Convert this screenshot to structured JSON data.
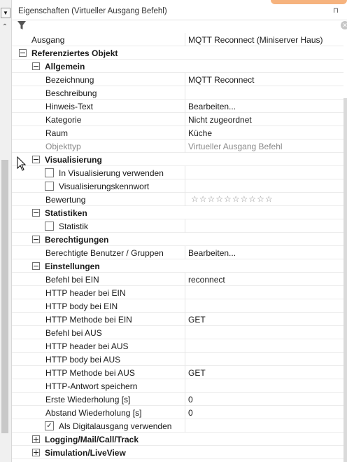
{
  "window": {
    "title": "Eigenschaften (Virtueller Ausgang Befehl)",
    "pin_glyph": "⊓",
    "clear_glyph": "✕"
  },
  "colors": {
    "accent": "#f6b37e",
    "disabled": "#8a8a8a"
  },
  "rows": {
    "ausgang": {
      "label": "Ausgang",
      "value": "MQTT Reconnect (Miniserver Haus)"
    },
    "ref_objekt": {
      "label": "Referenziertes Objekt"
    },
    "allgemein": {
      "label": "Allgemein"
    },
    "bezeichnung": {
      "label": "Bezeichnung",
      "value": "MQTT Reconnect"
    },
    "beschreibung": {
      "label": "Beschreibung",
      "value": ""
    },
    "hinweis": {
      "label": "Hinweis-Text",
      "value": "Bearbeiten..."
    },
    "kategorie": {
      "label": "Kategorie",
      "value": "Nicht zugeordnet"
    },
    "raum": {
      "label": "Raum",
      "value": "Küche"
    },
    "objekttyp": {
      "label": "Objekttyp",
      "value": "Virtueller Ausgang Befehl"
    },
    "visualisierung": {
      "label": "Visualisierung"
    },
    "in_visu": {
      "label": "In Visualisierung verwenden",
      "checked": false
    },
    "visu_kennwort": {
      "label": "Visualisierungskennwort",
      "checked": false
    },
    "bewertung": {
      "label": "Bewertung",
      "stars": "☆☆☆☆☆☆☆☆☆☆",
      "rating": 0
    },
    "statistiken": {
      "label": "Statistiken"
    },
    "statistik": {
      "label": "Statistik",
      "checked": false
    },
    "berechtigungen": {
      "label": "Berechtigungen"
    },
    "benutzer": {
      "label": "Berechtigte Benutzer / Gruppen",
      "value": "Bearbeiten..."
    },
    "einstellungen": {
      "label": "Einstellungen"
    },
    "befehl_ein": {
      "label": "Befehl bei EIN",
      "value": "reconnect"
    },
    "header_ein": {
      "label": "HTTP header bei EIN",
      "value": ""
    },
    "body_ein": {
      "label": "HTTP body bei EIN",
      "value": ""
    },
    "methode_ein": {
      "label": "HTTP Methode bei EIN",
      "value": "GET"
    },
    "befehl_aus": {
      "label": "Befehl bei AUS",
      "value": ""
    },
    "header_aus": {
      "label": "HTTP header bei AUS",
      "value": ""
    },
    "body_aus": {
      "label": "HTTP body bei AUS",
      "value": ""
    },
    "methode_aus": {
      "label": "HTTP Methode bei AUS",
      "value": "GET"
    },
    "antwort": {
      "label": "HTTP-Antwort speichern",
      "value": ""
    },
    "erste_wdh": {
      "label": "Erste Wiederholung [s]",
      "value": "0"
    },
    "abstand_wdh": {
      "label": "Abstand Wiederholung [s]",
      "value": "0"
    },
    "digital": {
      "label": "Als Digitalausgang verwenden",
      "checked": true,
      "check_glyph": "✓"
    },
    "logging": {
      "label": "Logging/Mail/Call/Track"
    },
    "simulation": {
      "label": "Simulation/LiveView"
    }
  }
}
